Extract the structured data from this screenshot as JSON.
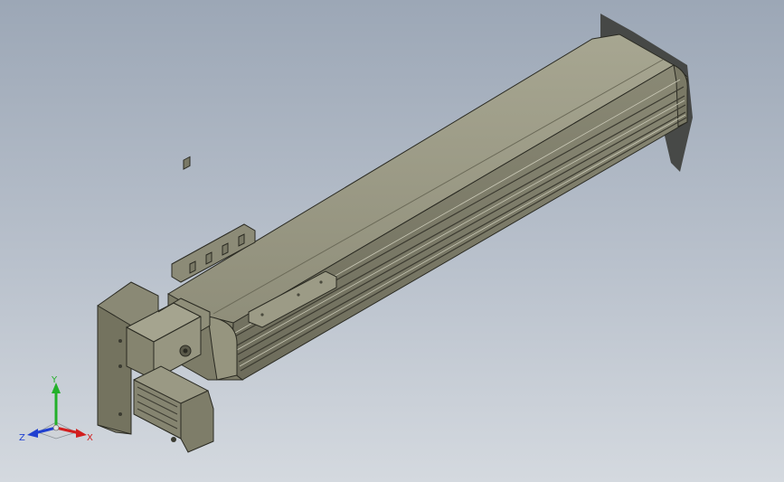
{
  "triad": {
    "x_label": "X",
    "y_label": "Y",
    "z_label": "Z",
    "colors": {
      "x": "#d21e1e",
      "y": "#23b02a",
      "z": "#2040d0"
    }
  },
  "model": {
    "name_icon": "linear-actuator-model",
    "colors": {
      "body": "#8c8b77",
      "body_light": "#a7a691",
      "body_dark": "#5d5c4d",
      "edge": "#2a2a22",
      "background_top": "#9ca7b6",
      "background_bottom": "#d4d9df"
    }
  }
}
